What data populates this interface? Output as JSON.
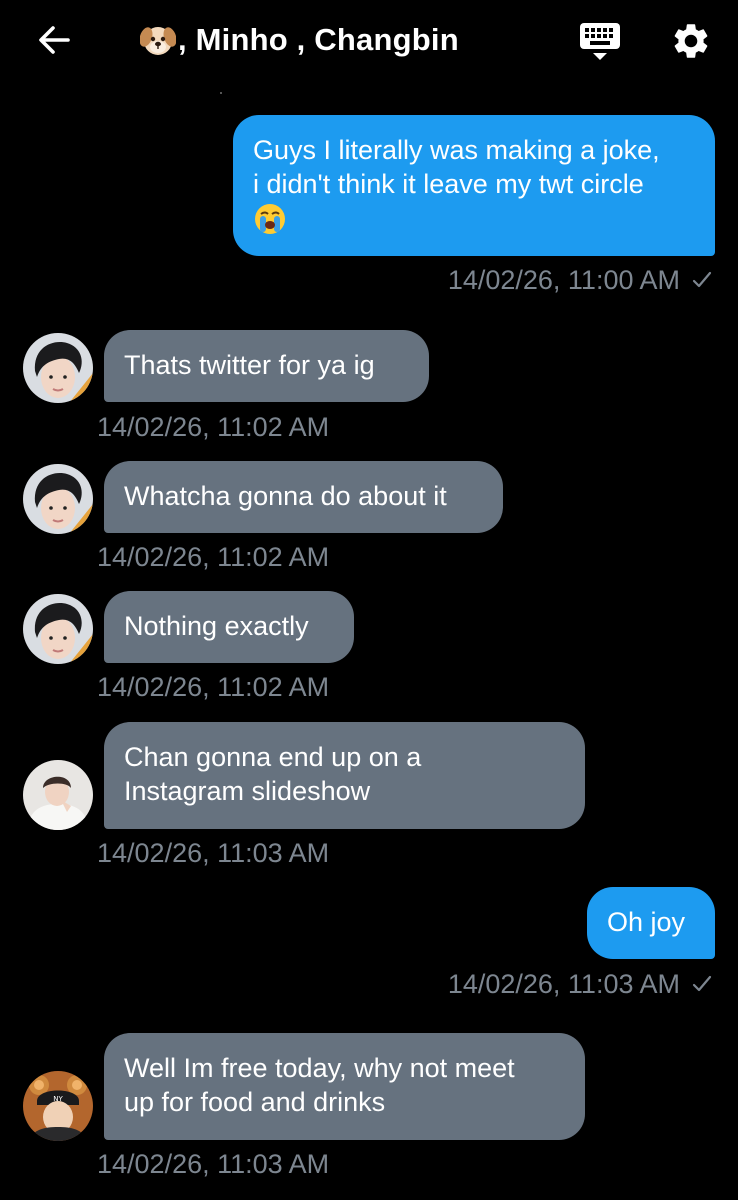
{
  "header": {
    "title_names": ", Minho , Changbin",
    "back_icon": "arrow-left-icon",
    "keyboard_icon": "keyboard-icon",
    "settings_icon": "gear-icon",
    "title_emoji_icon": "dog-face-emoji"
  },
  "colors": {
    "background": "#000000",
    "outgoing_bubble": "#1d9bf0",
    "incoming_bubble": "#66727f",
    "timestamp": "#7d8690"
  },
  "messages": [
    {
      "direction": "outgoing",
      "text": "Guys I literally was making a joke,\ni didn't think it leave my twt circle",
      "emoji": "loudly-crying-face-emoji",
      "timestamp": "14/02/26, 11:00 AM",
      "read": true
    },
    {
      "direction": "incoming",
      "avatar": "avatar-changbin",
      "text": "Thats twitter for ya ig",
      "timestamp": "14/02/26, 11:02 AM"
    },
    {
      "direction": "incoming",
      "avatar": "avatar-changbin",
      "text": "Whatcha gonna do about it",
      "timestamp": "14/02/26, 11:02 AM"
    },
    {
      "direction": "incoming",
      "avatar": "avatar-changbin",
      "text": "Nothing exactly",
      "timestamp": "14/02/26, 11:02 AM"
    },
    {
      "direction": "incoming",
      "avatar": "avatar-white-hoodie",
      "text": "Chan gonna end up on a\nInstagram slideshow",
      "timestamp": "14/02/26, 11:03 AM"
    },
    {
      "direction": "outgoing",
      "text": "Oh joy",
      "timestamp": "14/02/26, 11:03 AM",
      "read": true
    },
    {
      "direction": "incoming",
      "avatar": "avatar-bear-ears",
      "text": "Well Im free today, why not meet\nup for food and drinks",
      "timestamp": "14/02/26, 11:03 AM"
    }
  ]
}
